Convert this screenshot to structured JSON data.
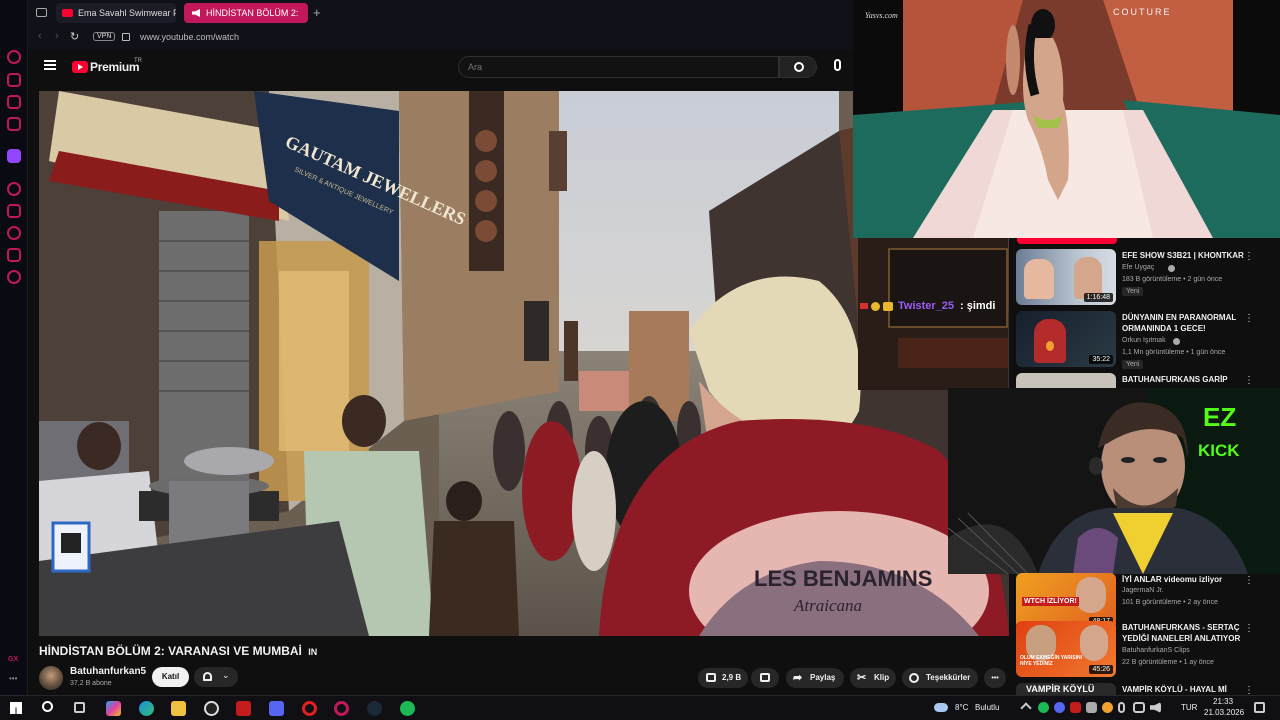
{
  "browser": {
    "tabs": [
      {
        "label": "Ema Savahl Swimwear Fas",
        "active": false
      },
      {
        "label": "HİNDİSTAN BÖLÜM 2:",
        "active": true
      }
    ],
    "new_tab_label": "+",
    "vpn_badge": "VPN",
    "url": "www.youtube.com/watch"
  },
  "youtube": {
    "brand": "Premium",
    "brand_sup": "TR",
    "search_placeholder": "Ara"
  },
  "overlay": {
    "watermark": "Yasvs.com",
    "brand_text": "COUTURE",
    "chat_user": "Twister_25",
    "chat_suffix": ": şimdi",
    "kick_logo_top": "EZ",
    "kick_logo_bottom": "KICK"
  },
  "scene": {
    "shop_sign": "GAUTAM JEWELLERS",
    "sign_sub": "SILVER & ANTIQUE JEWELLERY",
    "shirt_text": "LES BENJAMINS",
    "shirt_script": "Atraicana"
  },
  "recommendations": [
    {
      "title": "EFE SHOW S3B21 | KHONTKAR",
      "channel": "Efe Uygaç",
      "meta": "183 B görüntüleme • 2 gün önce",
      "badge": "Yeni",
      "duration": "1:16:48"
    },
    {
      "title": "DÜNYANIN EN PARANORMAL ORMANINDA 1 GECE!",
      "channel": "Orkun Işıtmak",
      "meta": "1,1 Mn görüntüleme • 1 gün önce",
      "badge": "Yeni",
      "duration": "35:22"
    },
    {
      "title": "BATUHANFURKANS GARİP",
      "channel": "",
      "meta": "",
      "badge": "",
      "duration": ""
    },
    {
      "title": "İYİ ANLAR videomu izliyor",
      "channel": "JagermaN Jr.",
      "meta": "101 B görüntüleme • 2 ay önce",
      "badge": "",
      "duration": "48:17",
      "thumb_caption": "WTCH İZLİYOR!"
    },
    {
      "title": "BATUHANFURKANS - SERTAÇ YEDİĞİ NANELERİ ANLATIYOR",
      "channel": "BatuhanfurkanS Clips",
      "meta": "22 B görüntüleme • 1 ay önce",
      "badge": "",
      "duration": "45:26",
      "thumb_caption": "OLUM EKMEĞİN YARISINI NİYE YEDİNİZ"
    },
    {
      "title": "VAMPİR KÖYLÜ - HAYAL Mİ",
      "channel": "",
      "meta": "",
      "badge": "",
      "duration": "",
      "thumb_caption": "VAMPİR KÖYLÜ"
    }
  ],
  "video": {
    "title": "HİNDİSTAN BÖLÜM 2: VARANASI VE MUMBAİ",
    "title_suffix": "IN",
    "channel": "Batuhanfurkan5",
    "subscribers": "37,2 B abone",
    "join_label": "Katıl",
    "likes": "2,9 B",
    "share_label": "Paylaş",
    "clip_label": "Klip",
    "thanks_label": "Teşekkürler",
    "more_label": "•••"
  },
  "taskbar": {
    "weather_temp": "8°C",
    "weather_text": "Bulutlu",
    "language": "TUR",
    "time": "21:33",
    "date": "21.03.2026"
  },
  "colors": {
    "accent": "#c2185b",
    "yt_red": "#ff0033",
    "kick_green": "#53fc18"
  }
}
